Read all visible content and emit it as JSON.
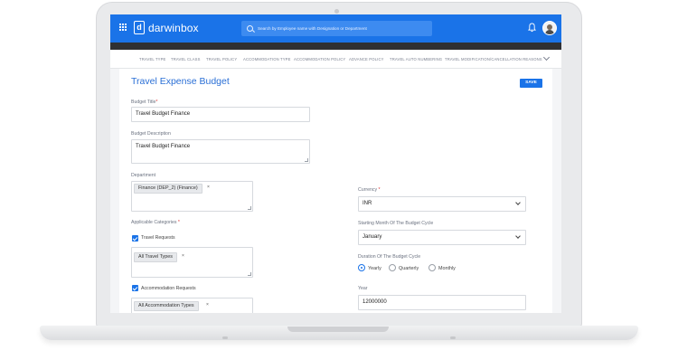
{
  "app": {
    "brand": "darwinbox",
    "brand_mark": "d",
    "search_placeholder": "Search by Employee name with Designation or Department"
  },
  "tabs": [
    "TRAVEL TYPE",
    "TRAVEL CLASS",
    "TRAVEL POLICY",
    "ACCOMMODATION TYPE",
    "ACCOMMODATION POLICY",
    "ADVANCE POLICY",
    "TRAVEL AUTO NUMBERING",
    "TRAVEL MODIFICATION/CANCELLATION REASONS"
  ],
  "page": {
    "title": "Travel Expense Budget",
    "save_label": "SAVE"
  },
  "form": {
    "budget_title_label": "Budget Title",
    "required_mark": "*",
    "budget_title_value": "Travel Budget Finance",
    "budget_description_label": "Budget Description",
    "budget_description_value": "Travel Budget Finance",
    "department_label": "Department",
    "department_chip": "Finance (DEP_2) (Finance)",
    "chip_remove": "×",
    "applicable_categories_label": "Applicable Categories",
    "travel_requests_label": "Travel Requests",
    "travel_types_chip": "All Travel Types",
    "accommodation_requests_label": "Accommodation Requests",
    "accommodation_types_chip": "All Accommodation Types",
    "currency_label": "Currency",
    "currency_value": "INR",
    "starting_month_label": "Starting Month Of The Budget Cycle",
    "starting_month_value": "January",
    "duration_label": "Duration Of The Budget Cycle",
    "duration_options": [
      "Yearly",
      "Quarterly",
      "Monthly"
    ],
    "duration_selected": "Yearly",
    "year_label": "Year",
    "year_value": "12000000"
  },
  "colors": {
    "brand_blue": "#1a73e8",
    "title_blue": "#2a6fd6",
    "dark_strip": "#2f3033"
  }
}
